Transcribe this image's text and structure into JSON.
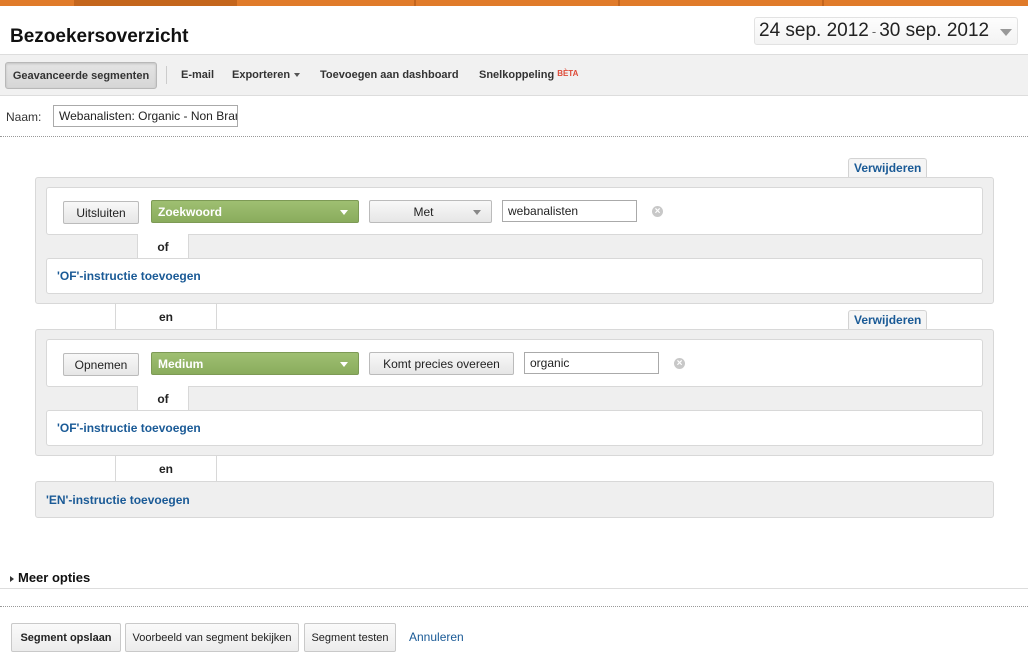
{
  "header": {
    "title": "Bezoekersoverzicht",
    "date_start": "24 sep. 2012",
    "date_separator": "-",
    "date_end": "30 sep. 2012"
  },
  "toolbar": {
    "advanced_segments": "Geavanceerde segmenten",
    "email": "E-mail",
    "export": "Exporteren",
    "add_dashboard": "Toevoegen aan dashboard",
    "shortcut": "Snelkoppeling",
    "beta": "BÈTA"
  },
  "segment": {
    "name_label": "Naam:",
    "name_value": "Webanalisten: Organic - Non Brand"
  },
  "conditions": [
    {
      "remove_label": "Verwijderen",
      "mode": "Uitsluiten",
      "dimension": "Zoekwoord",
      "operator": "Met",
      "value": "webanalisten",
      "or_connector": "of",
      "add_or": "'OF'-instructie toevoegen"
    },
    {
      "remove_label": "Verwijderen",
      "mode": "Opnemen",
      "dimension": "Medium",
      "operator": "Komt precies overeen",
      "value": "organic",
      "or_connector": "of",
      "add_or": "'OF'-instructie toevoegen"
    }
  ],
  "and_connector": "en",
  "add_and": "'EN'-instructie toevoegen",
  "more_options": "Meer opties",
  "footer": {
    "save": "Segment opslaan",
    "preview": "Voorbeeld van segment bekijken",
    "test": "Segment testen",
    "cancel": "Annuleren"
  },
  "colors": {
    "accent_orange": "#e07b2a",
    "dimension_green": "#94b566",
    "link_blue": "#1a5a96"
  }
}
